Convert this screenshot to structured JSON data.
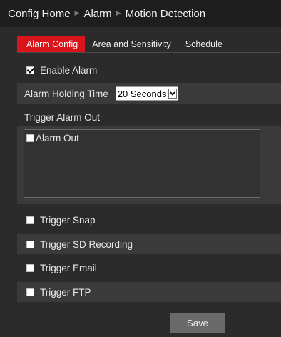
{
  "breadcrumb": {
    "items": [
      "Config Home",
      "Alarm",
      "Motion Detection"
    ],
    "separator_icon": "triangle-right-icon"
  },
  "tabs": [
    {
      "label": "Alarm Config",
      "active": true
    },
    {
      "label": "Area and Sensitivity",
      "active": false
    },
    {
      "label": "Schedule",
      "active": false
    }
  ],
  "enable_alarm": {
    "label": "Enable Alarm",
    "checked": true
  },
  "holding_time": {
    "label": "Alarm Holding Time",
    "value": "20 Seconds"
  },
  "trigger_alarm_out": {
    "heading": "Trigger Alarm Out",
    "items": [
      {
        "label": "Alarm Out",
        "checked": false
      }
    ]
  },
  "triggers": [
    {
      "label": "Trigger Snap",
      "checked": false
    },
    {
      "label": "Trigger SD Recording",
      "checked": false
    },
    {
      "label": "Trigger Email",
      "checked": false
    },
    {
      "label": "Trigger FTP",
      "checked": false
    }
  ],
  "save_label": "Save",
  "colors": {
    "accent": "#d9141b",
    "background": "#2b2b2b",
    "row_shade": "#3a3a3a",
    "header": "#1e1e1e"
  }
}
